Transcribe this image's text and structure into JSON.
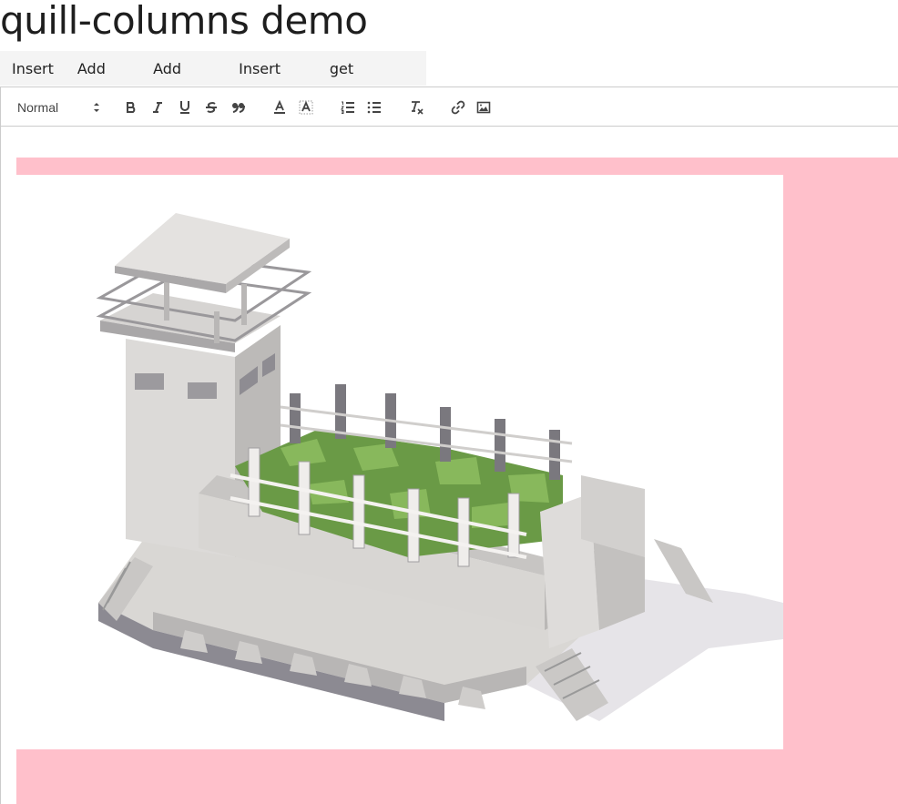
{
  "page": {
    "title": "quill-columns demo"
  },
  "buttons": [
    "Insert",
    "Add left",
    "Add right",
    "Insert line",
    "get contents"
  ],
  "toolbar": {
    "header_value": "Normal",
    "icons": [
      "bold-icon",
      "italic-icon",
      "underline-icon",
      "strike-icon",
      "blockquote-icon",
      "text-color-icon",
      "background-color-icon",
      "ordered-list-icon",
      "bullet-list-icon",
      "clean-format-icon",
      "link-icon",
      "image-icon"
    ]
  },
  "content": {
    "column_background": "#ffc0cb",
    "image_subject": "low-poly prison watchtower illustration"
  }
}
